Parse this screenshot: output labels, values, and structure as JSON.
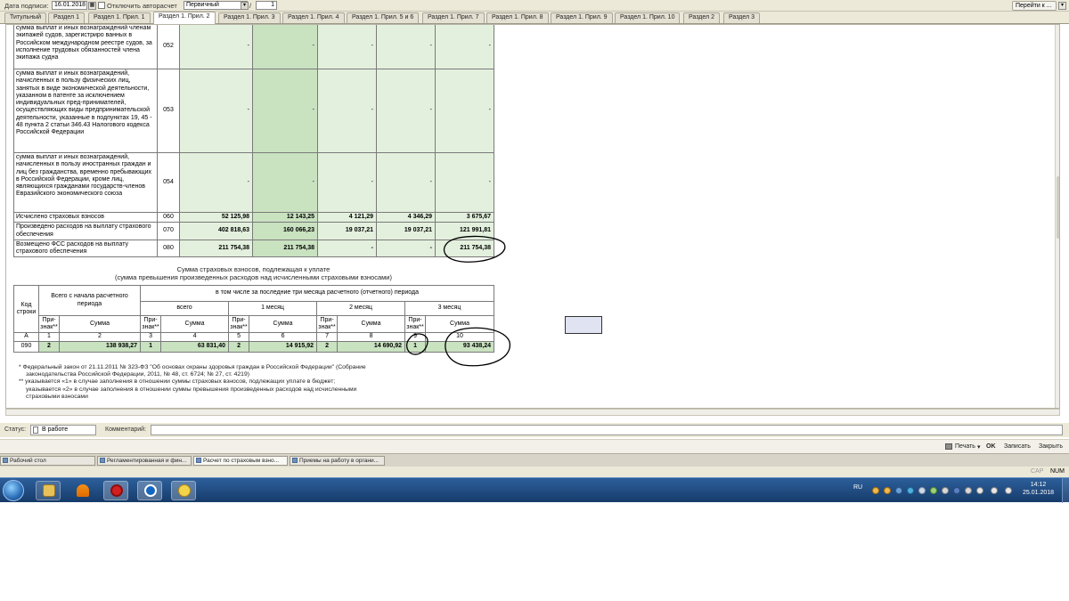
{
  "toolbar": {
    "date_label": "Дата подписи:",
    "date_value": "16.01.2018",
    "autocalc_label": "Отключить авторасчет",
    "type_value": "Первичный",
    "page_sep": "/",
    "page_total": "1",
    "goto_label": "Перейти к ..."
  },
  "tabs": [
    "Титульный",
    "Раздел 1",
    "Раздел 1. Прил. 1",
    "Раздел 1. Прил. 2",
    "Раздел 1. Прил. 3",
    "Раздел 1. Прил. 4",
    "Раздел 1. Прил. 5 и 6",
    "Раздел 1. Прил. 7",
    "Раздел 1. Прил. 8",
    "Раздел 1. Прил. 9",
    "Раздел 1. Прил. 10",
    "Раздел 2",
    "Раздел 3"
  ],
  "active_tab": "Раздел 1. Прил. 2",
  "table1": {
    "rows": [
      {
        "desc": "сумма выплат и иных вознаграждений членам экипажей судов, зарегистриро ванных в Российском международном реестре судов, за исполнение трудовых обязанностей члена экипажа судна",
        "code": "052",
        "c1": "-",
        "c2": "-",
        "c3": "-",
        "c4": "-",
        "c5": "-"
      },
      {
        "desc": "сумма выплат и иных вознаграждений, начисленных в пользу физических лиц, занятых в виде экономической деятельности, указанном в патенте за исключением индивидуальных пред-принимателей, осуществляющих виды предпринимательской деятельности, указанные в подпунктах 19, 45 - 48 пункта 2 статьи 346.43 Налогового кодекса Российской Федерации",
        "code": "053",
        "c1": "-",
        "c2": "-",
        "c3": "-",
        "c4": "-",
        "c5": "-"
      },
      {
        "desc": "сумма выплат и иных вознаграждений, начисленных в пользу иностранных граждан и лиц без гражданства, временно пребывающих в Российской Федерации, кроме лиц, являющихся гражданами государств-членов Евразийского экономического союза",
        "code": "054",
        "c1": "-",
        "c2": "-",
        "c3": "-",
        "c4": "-",
        "c5": "-"
      },
      {
        "desc": "Исчислено страховых взносов",
        "code": "060",
        "c1": "52 125,98",
        "c2": "12 143,25",
        "c3": "4 121,29",
        "c4": "4 346,29",
        "c5": "3 675,67"
      },
      {
        "desc": "Произведено расходов на выплату страхового обеспечения",
        "code": "070",
        "c1": "402 818,63",
        "c2": "160 066,23",
        "c3": "19 037,21",
        "c4": "19 037,21",
        "c5": "121 991,81"
      },
      {
        "desc": "Возмещено ФСС расходов на выплату страхового обеспечения",
        "code": "080",
        "c1": "211 754,38",
        "c2": "211 754,38",
        "c3": "-",
        "c4": "-",
        "c5": "211 754,38"
      }
    ]
  },
  "section2": {
    "caption_line1": "Сумма страховых взносов, подлежащая к уплате",
    "caption_line2": "(сумма превышения произведенных расходов над исчисленными страховыми взносами)",
    "h_code": "Код строки",
    "h_total": "Всего с начала расчетного периода",
    "h_last3": "в том числе за последние три месяца расчетного (отчетного) периода",
    "h_all": "всего",
    "h_m1": "1 месяц",
    "h_m2": "2 месяц",
    "h_m3": "3 месяц",
    "h_sign": "При-знак**",
    "h_sum": "Сумма",
    "idx": [
      "А",
      "1",
      "2",
      "3",
      "4",
      "5",
      "6",
      "7",
      "8",
      "9",
      "10"
    ],
    "row": {
      "code": "090",
      "s1": "2",
      "v1": "138 938,27",
      "s2": "1",
      "v2": "63 831,40",
      "s3": "2",
      "v3": "14 915,92",
      "s4": "2",
      "v4": "14 690,92",
      "s5": "1",
      "v5": "93 438,24"
    }
  },
  "footnotes": {
    "f1_line1": "*  Федеральный закон от 21.11.2011 № 323-ФЗ \"Об основах охраны здоровья граждан в Российской Федерации\" (Собрание",
    "f1_line2": "законодательства Российской Федерации, 2011, № 48, ст. 6724; № 27, ст. 4219)",
    "f2_line1": "** указывается «1» в случае заполнения в отношении суммы страховых взносов, подлежащих уплате в бюджет;",
    "f2_line2": "указывается «2» в случае заполнения в отношении суммы превышения произведенных расходов над исчисленными",
    "f2_line3": "страховыми взносами"
  },
  "status": {
    "status_label": "Статус:",
    "status_value": "В работе",
    "comment_label": "Комментарий:",
    "comment_value": ""
  },
  "actions": {
    "print": "Печать",
    "ok": "OK",
    "save": "Записать",
    "close": "Закрыть"
  },
  "windows": [
    "Рабочий стол",
    "Регламентированная и фин...",
    "Расчет по страховым взно...",
    "Приемы на работу в органи..."
  ],
  "indicators": {
    "cap": "CAP",
    "num": "NUM"
  },
  "taskbar": {
    "lang": "RU",
    "time": "14:12",
    "date": "25.01.2018",
    "app_icons": [
      "folder-icon",
      "vlc-icon",
      "opera-icon",
      "teamviewer-icon",
      "1c-icon"
    ]
  }
}
